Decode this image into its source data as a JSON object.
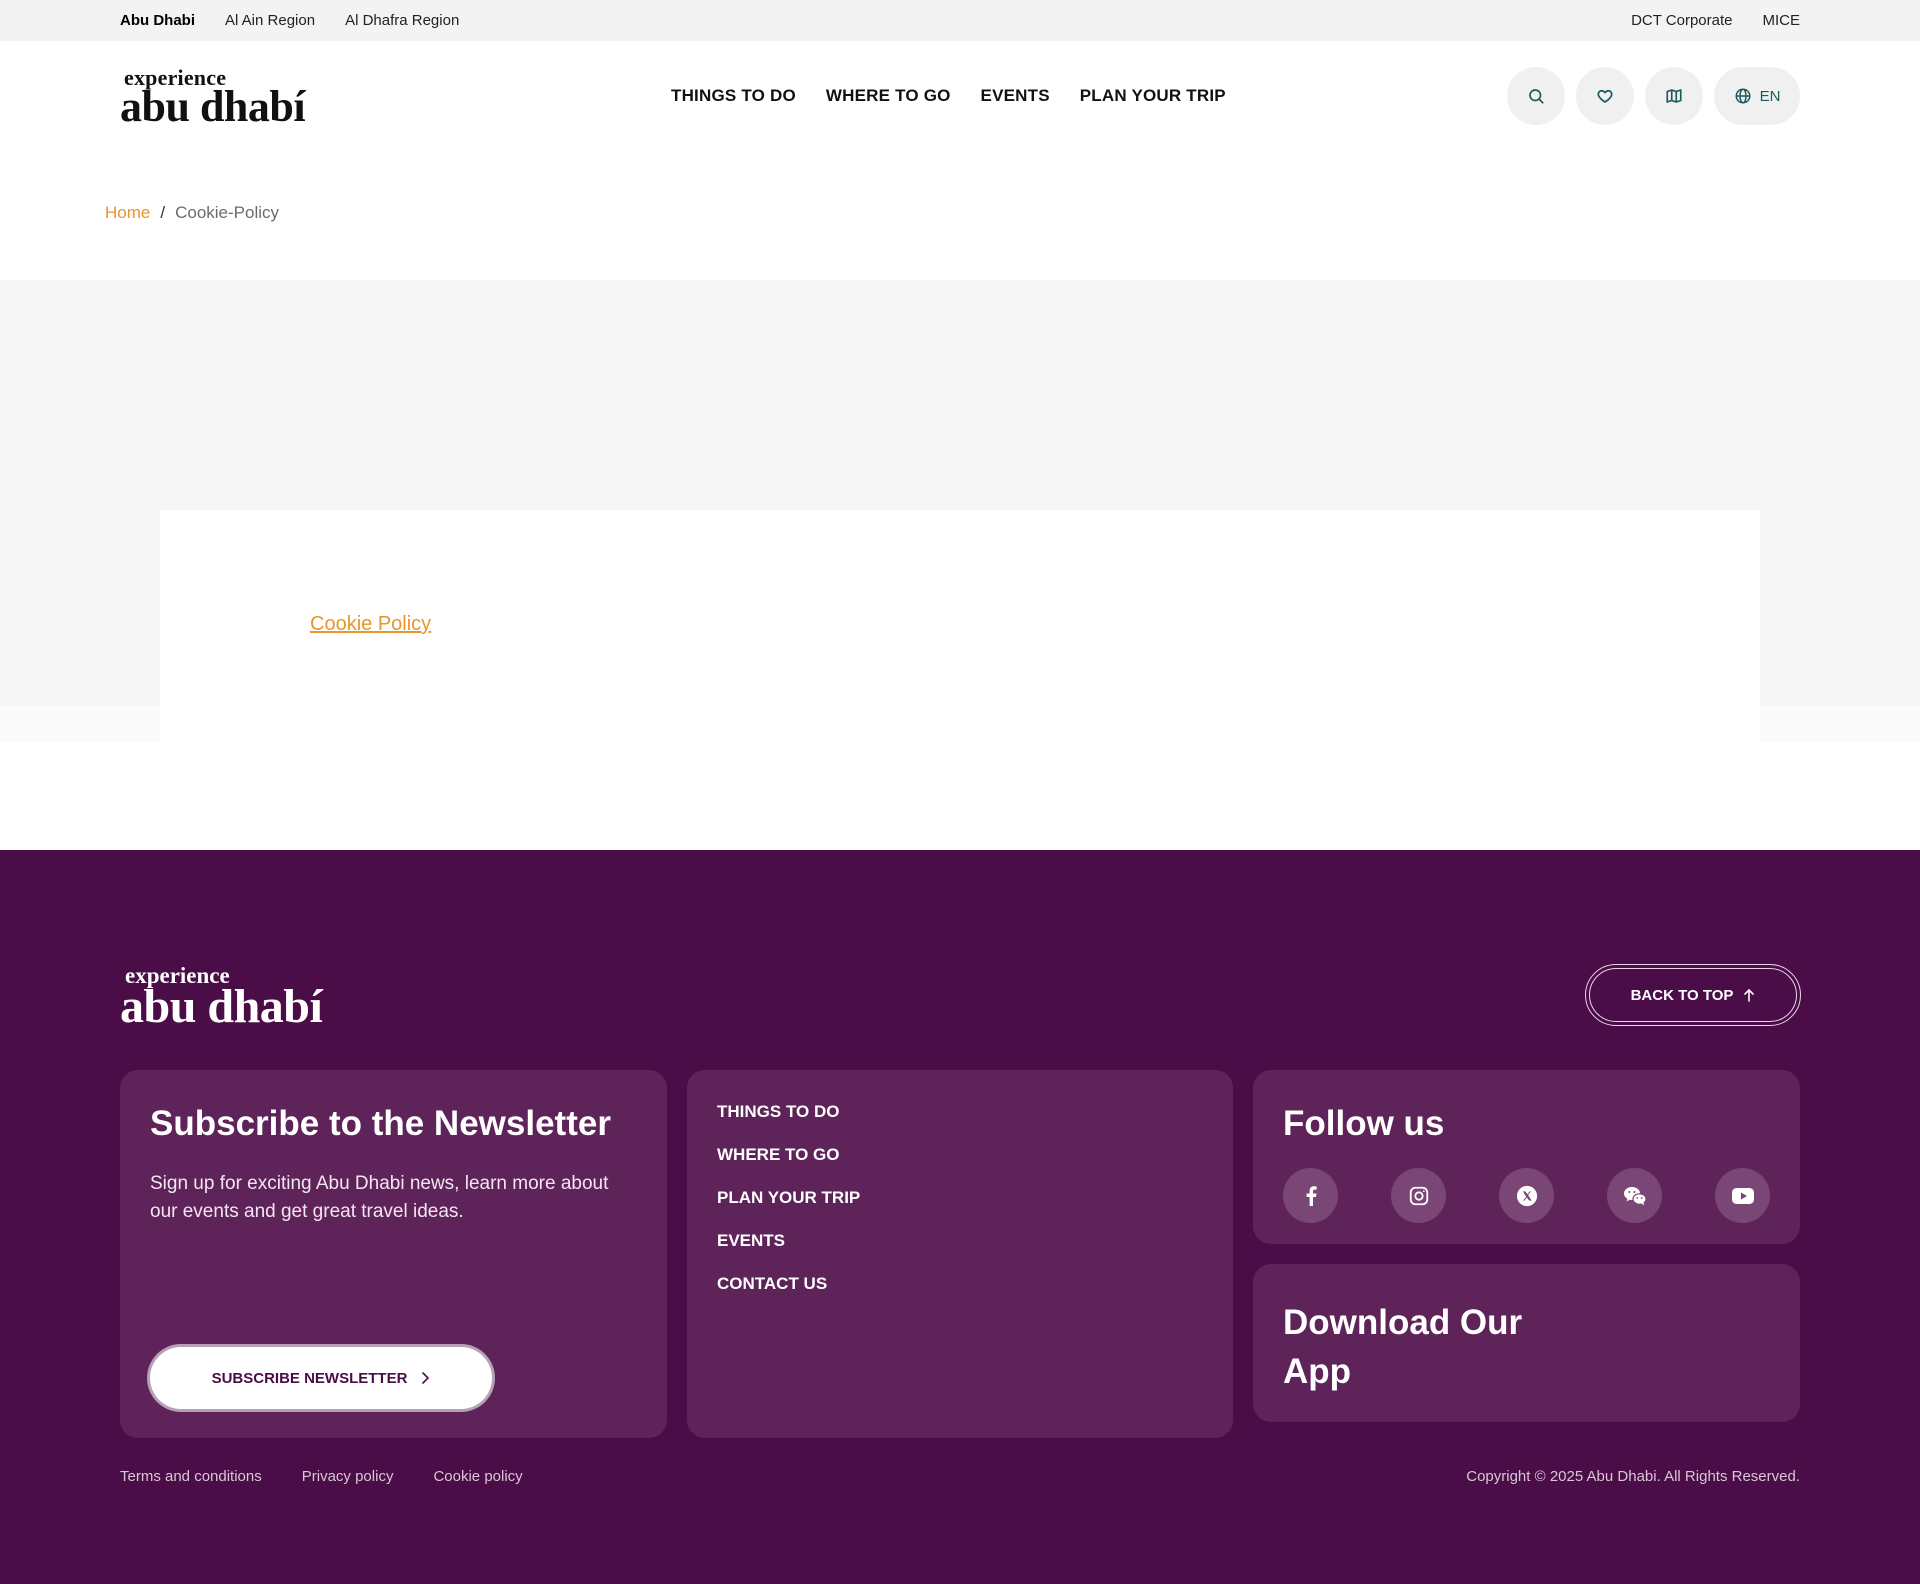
{
  "topbar": {
    "regions": [
      "Abu Dhabi",
      "Al Ain Region",
      "Al Dhafra Region"
    ],
    "right_links": [
      "DCT Corporate",
      "MICE"
    ]
  },
  "header": {
    "logo_small": "experience",
    "logo_big": "abu dhabí",
    "nav": [
      "THINGS TO DO",
      "WHERE TO GO",
      "EVENTS",
      "PLAN YOUR TRIP"
    ],
    "icons": [
      "search-icon",
      "heart-icon",
      "map-icon",
      "globe-icon"
    ],
    "language": "EN"
  },
  "breadcrumb": {
    "home": "Home",
    "separator": "/",
    "current": "Cookie-Policy"
  },
  "content": {
    "link": "Cookie Policy"
  },
  "footer": {
    "logo_small": "experience",
    "logo_big": "abu dhabí",
    "back_to_top": "BACK TO TOP",
    "newsletter": {
      "title": "Subscribe to the Newsletter",
      "text": "Sign up for exciting Abu Dhabi news, learn more about our events and get great travel ideas.",
      "button": "SUBSCRIBE NEWSLETTER"
    },
    "links": [
      "THINGS TO DO",
      "WHERE TO GO",
      "PLAN YOUR TRIP",
      "EVENTS",
      "CONTACT US"
    ],
    "follow": {
      "title": "Follow us",
      "icons": [
        "facebook-icon",
        "instagram-icon",
        "x-icon",
        "wechat-icon",
        "youtube-icon"
      ]
    },
    "app": {
      "title": "Download Our App"
    },
    "legal": [
      "Terms and conditions",
      "Privacy policy",
      "Cookie policy"
    ],
    "copyright": "Copyright © 2025 Abu Dhabi. All Rights Reserved."
  },
  "colors": {
    "accent": "#e8962a",
    "footer_bg": "#4b0d47",
    "footer_card": "#5e2459",
    "icon_teal": "#1a5b5b"
  }
}
